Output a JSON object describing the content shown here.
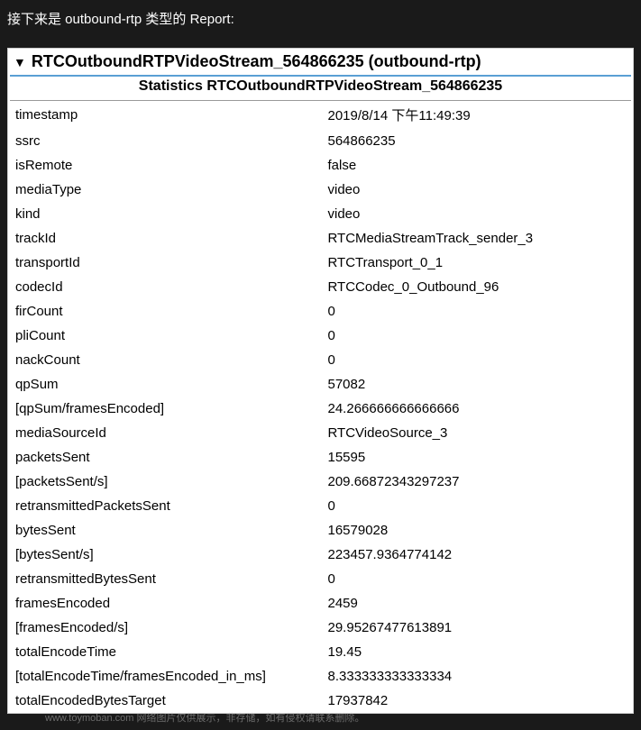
{
  "intro": "接下来是 outbound-rtp 类型的 Report:",
  "header": {
    "title": "RTCOutboundRTPVideoStream_564866235 (outbound-rtp)",
    "subtitle": "Statistics RTCOutboundRTPVideoStream_564866235"
  },
  "stats": [
    {
      "key": "timestamp",
      "value": "2019/8/14 下午11:49:39"
    },
    {
      "key": "ssrc",
      "value": "564866235"
    },
    {
      "key": "isRemote",
      "value": "false"
    },
    {
      "key": "mediaType",
      "value": "video"
    },
    {
      "key": "kind",
      "value": "video"
    },
    {
      "key": "trackId",
      "value": "RTCMediaStreamTrack_sender_3"
    },
    {
      "key": "transportId",
      "value": "RTCTransport_0_1"
    },
    {
      "key": "codecId",
      "value": "RTCCodec_0_Outbound_96"
    },
    {
      "key": "firCount",
      "value": "0"
    },
    {
      "key": "pliCount",
      "value": "0"
    },
    {
      "key": "nackCount",
      "value": "0"
    },
    {
      "key": "qpSum",
      "value": "57082"
    },
    {
      "key": "[qpSum/framesEncoded]",
      "value": "24.266666666666666"
    },
    {
      "key": "mediaSourceId",
      "value": "RTCVideoSource_3"
    },
    {
      "key": "packetsSent",
      "value": "15595"
    },
    {
      "key": "[packetsSent/s]",
      "value": "209.66872343297237"
    },
    {
      "key": "retransmittedPacketsSent",
      "value": "0"
    },
    {
      "key": "bytesSent",
      "value": "16579028"
    },
    {
      "key": "[bytesSent/s]",
      "value": "223457.9364774142"
    },
    {
      "key": "retransmittedBytesSent",
      "value": "0"
    },
    {
      "key": "framesEncoded",
      "value": "2459"
    },
    {
      "key": "[framesEncoded/s]",
      "value": "29.95267477613891"
    },
    {
      "key": "totalEncodeTime",
      "value": "19.45"
    },
    {
      "key": "[totalEncodeTime/framesEncoded_in_ms]",
      "value": "8.333333333333334"
    },
    {
      "key": "totalEncodedBytesTarget",
      "value": "17937842"
    }
  ],
  "watermark": "www.toymoban.com 网络图片仅供展示，非存储，如有侵权请联系删除。"
}
